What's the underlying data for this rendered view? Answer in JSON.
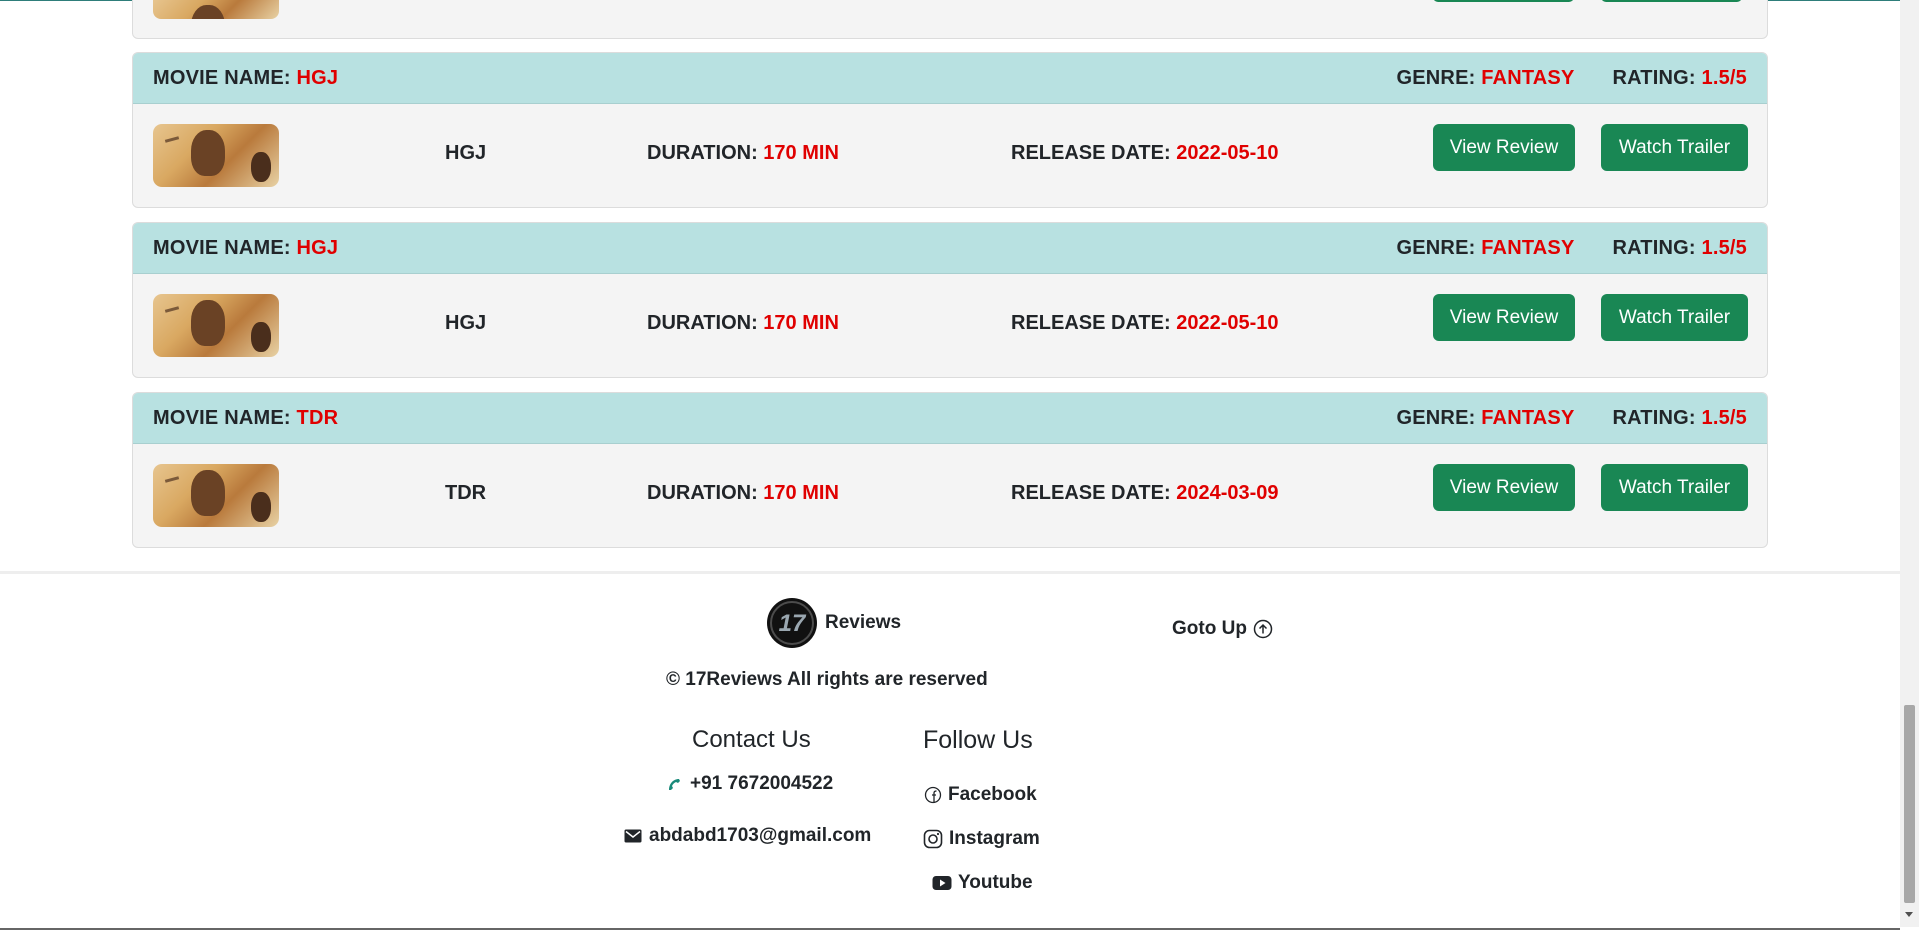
{
  "labels": {
    "movie_name": "MOVIE NAME:",
    "genre": "GENRE:",
    "rating": "RATING:",
    "duration": "DURATION:",
    "release_date": "RELEASE DATE:",
    "view_review": "View Review",
    "watch_trailer": "Watch Trailer"
  },
  "movies": [
    {
      "name": "HGJ",
      "title": "HGJ",
      "genre": "FANTASY",
      "rating": "1.5/5",
      "duration": "170 MIN",
      "release_date": "2022-05-10"
    },
    {
      "name": "HGJ",
      "title": "HGJ",
      "genre": "FANTASY",
      "rating": "1.5/5",
      "duration": "170 MIN",
      "release_date": "2022-05-10"
    },
    {
      "name": "TDR",
      "title": "TDR",
      "genre": "FANTASY",
      "rating": "1.5/5",
      "duration": "170 MIN",
      "release_date": "2024-03-09"
    }
  ],
  "footer": {
    "logo_text": "17",
    "brand": "Reviews",
    "goto_up": "Goto Up",
    "copyright": "© 17Reviews All rights are reserved",
    "contact_heading": "Contact Us",
    "phone": "+91 7672004522",
    "email": "abdabd1703@gmail.com",
    "follow_heading": "Follow Us",
    "socials": [
      "Facebook",
      "Instagram",
      "Youtube"
    ]
  },
  "colors": {
    "accent_red": "#e00000",
    "header_bg": "#b8e1e1",
    "button_green": "#198754"
  },
  "icons": [
    "phone-icon",
    "mail-icon",
    "facebook-icon",
    "instagram-icon",
    "youtube-icon",
    "arrow-up-circle-icon"
  ]
}
